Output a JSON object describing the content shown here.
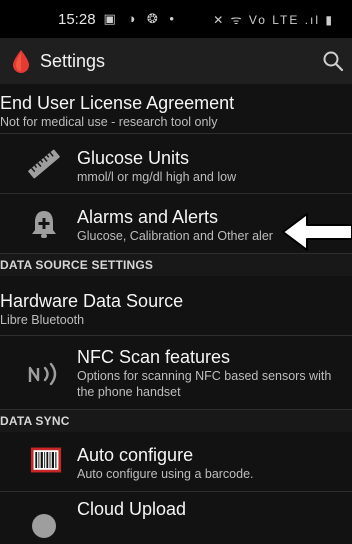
{
  "status_bar": {
    "time": "15:28",
    "left_icons": "▣ ◑ ❂ •",
    "right_icons": "✕ ᯤ Vo LTE .ıl ▮"
  },
  "app_bar": {
    "title": "Settings",
    "logo_icon": "blood-drop-icon",
    "search_icon": "search-icon"
  },
  "items": {
    "eula": {
      "title": "End User License Agreement",
      "subtitle": "Not for medical use - research tool only"
    },
    "glucose_units": {
      "title": "Glucose Units",
      "subtitle": "mmol/l or mg/dl high and low",
      "icon": "ruler-icon"
    },
    "alarms": {
      "title": "Alarms and Alerts",
      "subtitle": "Glucose, Calibration and Other aler",
      "icon": "alarm-bell-icon"
    },
    "hardware_source": {
      "title": "Hardware Data Source",
      "subtitle": "Libre Bluetooth"
    },
    "nfc": {
      "title": "NFC Scan features",
      "subtitle": "Options for scanning NFC based sensors with the phone handset",
      "icon": "nfc-icon"
    },
    "auto_configure": {
      "title": "Auto configure",
      "subtitle": "Auto configure using a barcode.",
      "icon": "barcode-icon"
    },
    "cloud_upload": {
      "title": "Cloud Upload",
      "icon": "cloud-icon"
    }
  },
  "sections": {
    "data_source": "DATA SOURCE SETTINGS",
    "data_sync": "DATA SYNC"
  },
  "colors": {
    "background": "#121212",
    "app_bar": "#1f1f1f",
    "logo_red": "#e53935",
    "barcode_red": "#c62828",
    "icon_grey": "#9e9e9e"
  },
  "annotation": {
    "icon": "left-arrow-icon",
    "color": "#ffffff"
  }
}
